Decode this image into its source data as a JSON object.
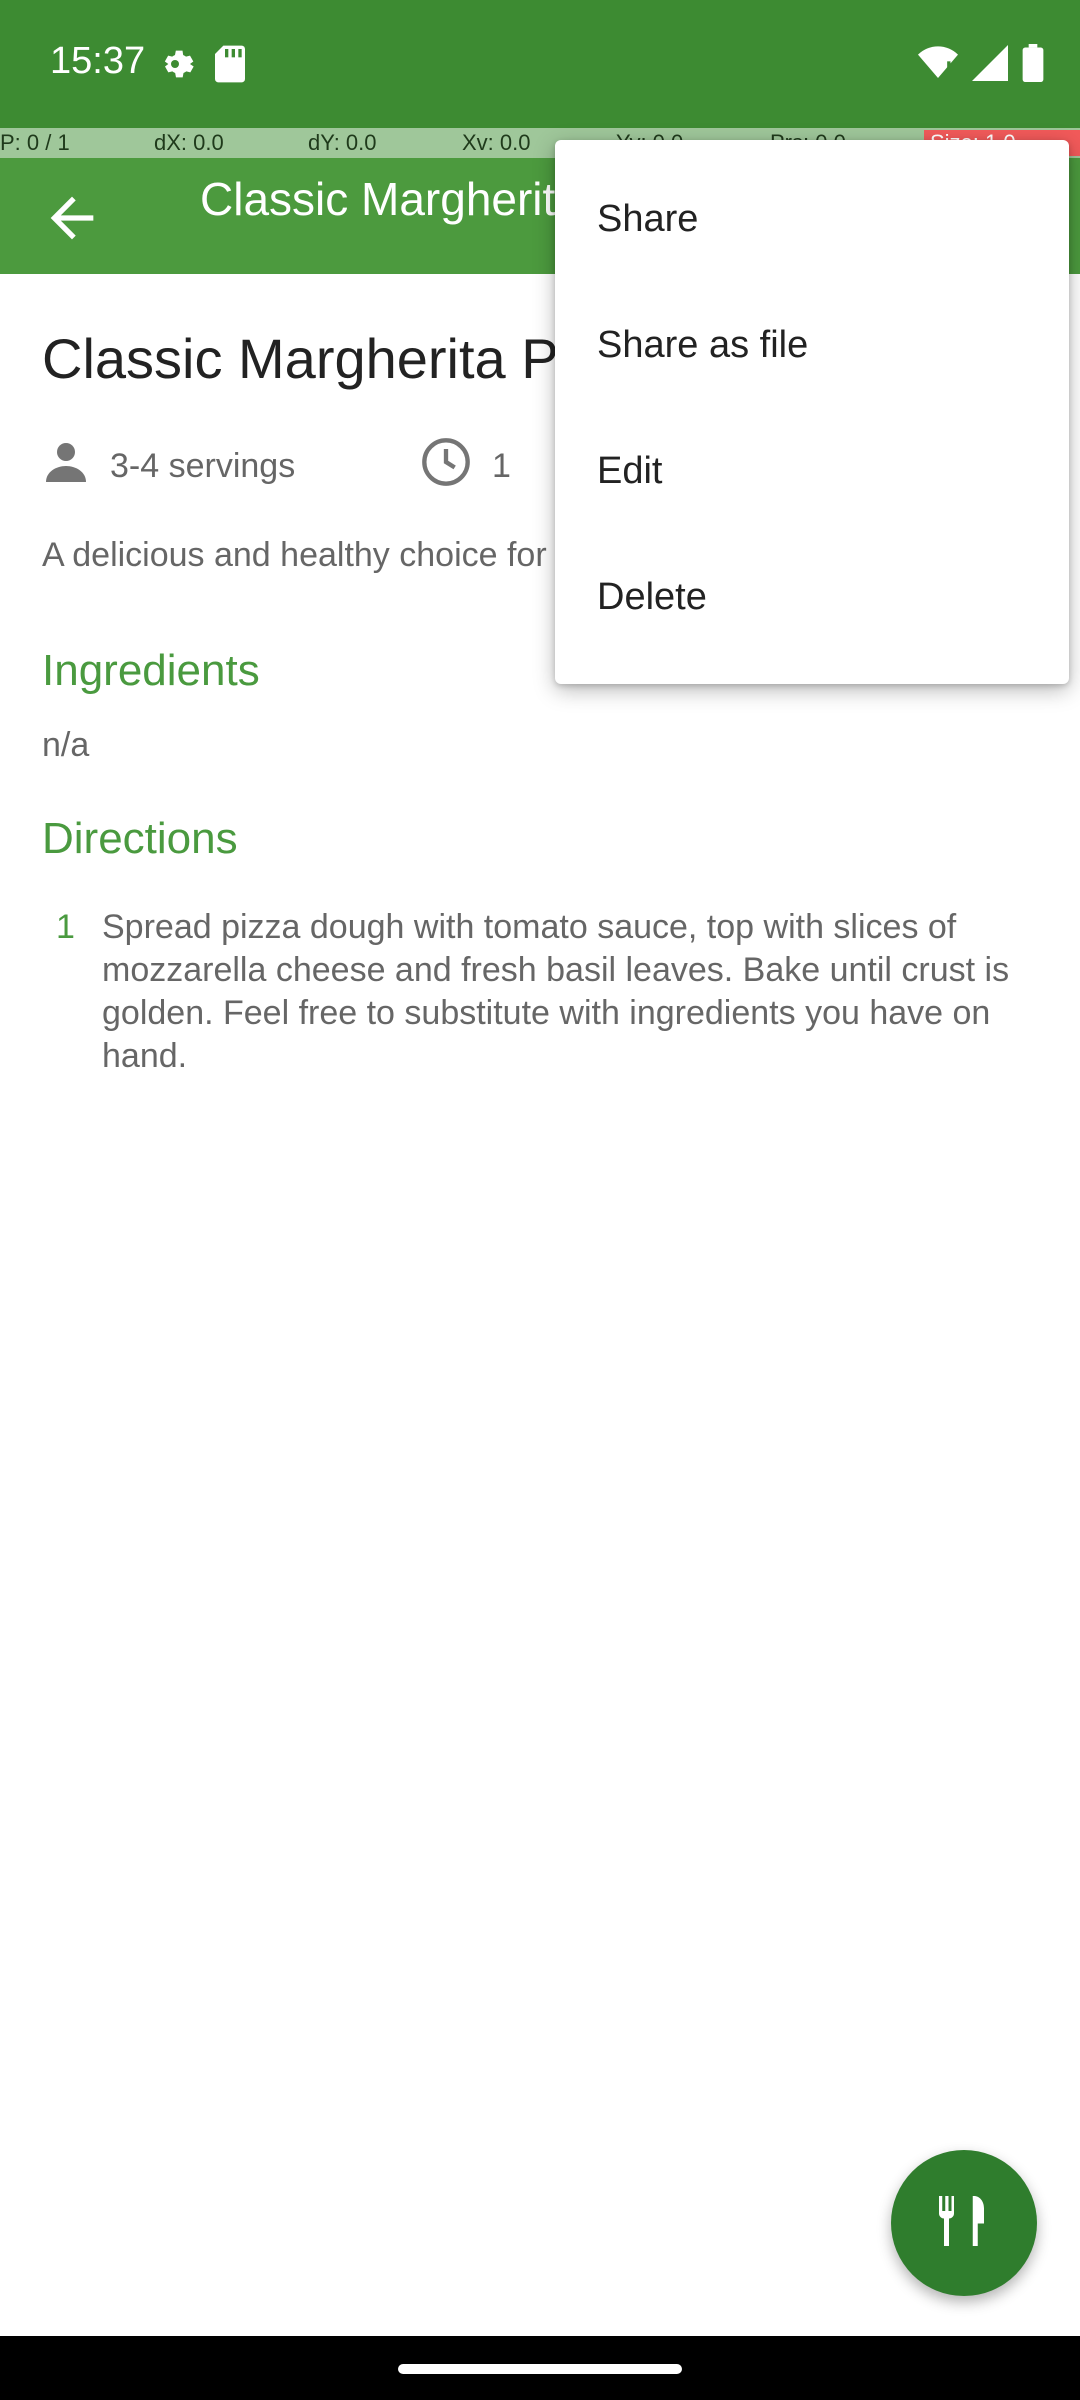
{
  "status_bar": {
    "time": "15:37",
    "icons_left": [
      "gear-icon",
      "sd-card-icon"
    ],
    "icons_right": [
      "wifi-icon",
      "signal-icon",
      "battery-icon"
    ]
  },
  "debug_bar": {
    "p": "P: 0 / 1",
    "dx": "dX: 0.0",
    "dy": "dY: 0.0",
    "xv": "Xv: 0.0",
    "yv": "Yv: 0.0",
    "prs": "Prs: 0.0",
    "size": "Size: 1.0"
  },
  "app_bar": {
    "title": "Classic Margherita Pizza",
    "back_icon": "arrow-back-icon"
  },
  "recipe": {
    "title": "Classic Margherita Pizza",
    "servings": "3-4 servings",
    "time": "1",
    "description": "A delicious and healthy choice for any time of the day.",
    "ingredients_heading": "Ingredients",
    "ingredients_value": "n/a",
    "directions_heading": "Directions",
    "steps": [
      {
        "number": "1",
        "text": "Spread pizza dough with tomato sauce, top with slices of mozzarella cheese and fresh basil leaves. Bake until crust is golden. Feel free to substitute with ingredients you have on hand."
      }
    ]
  },
  "menu": {
    "items": [
      "Share",
      "Share as file",
      "Edit",
      "Delete"
    ]
  },
  "fab": {
    "icon": "utensils-icon"
  },
  "colors": {
    "primary": "#4c9a3e",
    "status_bar": "#3d8b32",
    "accent": "#4a9a3f",
    "fab": "#2f7d2d"
  }
}
